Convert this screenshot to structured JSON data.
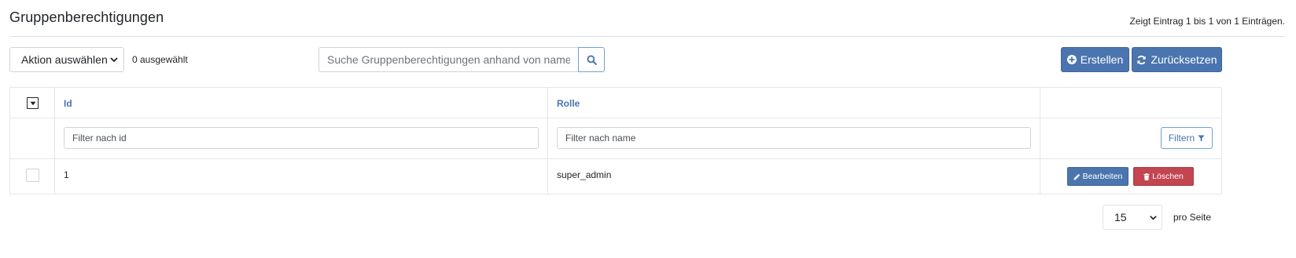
{
  "header": {
    "title": "Gruppenberechtigungen",
    "entry_info": "Zeigt Eintrag 1 bis 1 von 1 Einträgen."
  },
  "toolbar": {
    "action_select": "Aktion auswählen",
    "selected_count": "0 ausgewählt",
    "search_placeholder": "Suche Gruppenberechtigungen anhand von name...",
    "create_label": "Erstellen",
    "reset_label": "Zurücksetzen"
  },
  "table": {
    "columns": [
      "Id",
      "Rolle"
    ],
    "filters": {
      "id_placeholder": "Filter nach id",
      "name_placeholder": "Filter nach name",
      "button_label": "Filtern"
    },
    "rows": [
      {
        "id": "1",
        "role": "super_admin",
        "edit_label": "Bearbeiten",
        "delete_label": "Löschen"
      }
    ]
  },
  "pagination": {
    "page_size": "15",
    "per_page_label": "pro Seite"
  },
  "colors": {
    "primary": "#4a75ae",
    "danger": "#c2454f",
    "header_text": "#4a75ae"
  },
  "icons": {
    "search": "search-icon",
    "create": "plus-circle-icon",
    "reset": "refresh-icon",
    "filter": "filter-icon",
    "edit": "pencil-icon",
    "delete": "trash-icon",
    "select_dropdown": "chevron-down-icon"
  }
}
